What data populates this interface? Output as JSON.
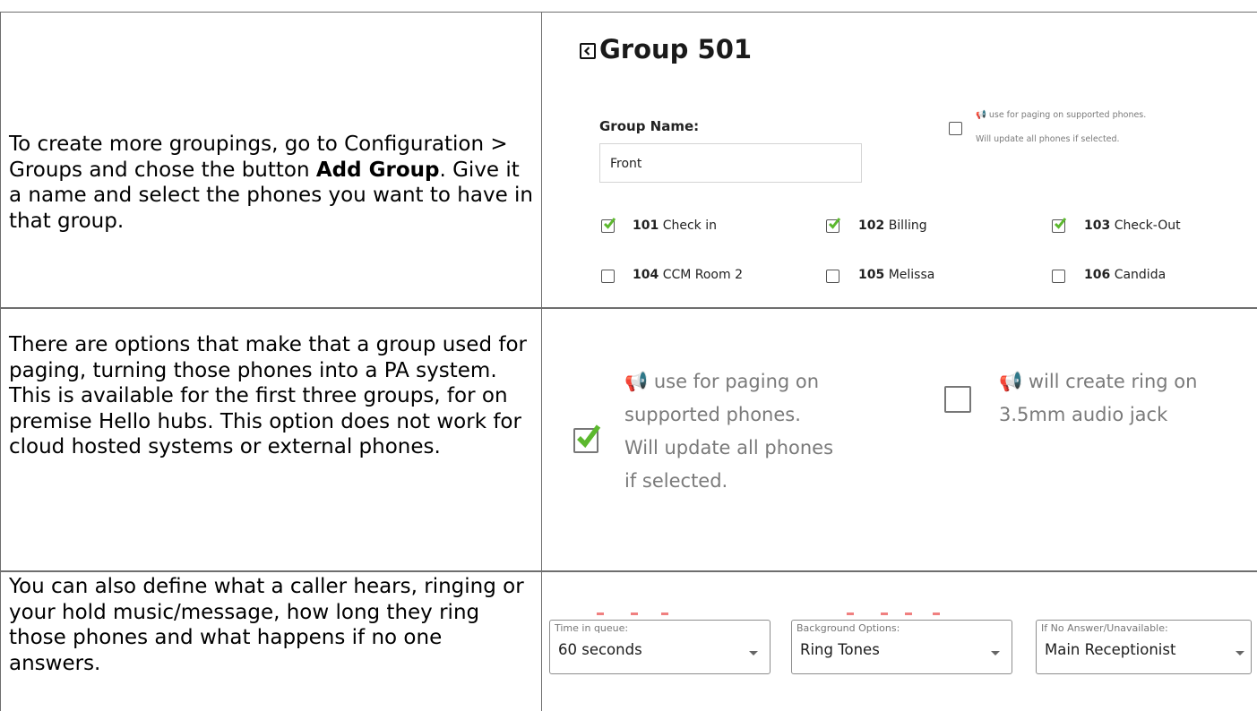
{
  "rows": [
    {
      "text_parts": {
        "before": "To create more groupings, go to Configuration > Groups and chose the button ",
        "bold": "Add Group",
        "after": ". Give it a name and select the phones you want to have in that group."
      }
    },
    {
      "text": "There are options that make that a group used for paging, turning those phones into a PA system. This is available for the first three groups, for on premise Hello hubs. This option does not work for cloud hosted systems or external phones."
    },
    {
      "text": "You can also define what a caller hears, ringing or your hold music/message, how long they ring those phones and what happens if no one answers."
    }
  ],
  "group_panel": {
    "title": "Group 501",
    "group_name_label": "Group Name:",
    "group_name_value": "Front",
    "paging_option": {
      "line1": "📢 use for paging on supported phones.",
      "line2": "Will update all phones if selected.",
      "checked": false
    },
    "phones": [
      {
        "ext": "101",
        "name": "Check in",
        "checked": true
      },
      {
        "ext": "102",
        "name": "Billing",
        "checked": true
      },
      {
        "ext": "103",
        "name": "Check-Out",
        "checked": true
      },
      {
        "ext": "104",
        "name": "CCM Room 2",
        "checked": false
      },
      {
        "ext": "105",
        "name": "Melissa",
        "checked": false
      },
      {
        "ext": "106",
        "name": "Candida",
        "checked": false
      }
    ]
  },
  "options_panel": {
    "paging": {
      "checked": true,
      "lines": [
        "📢 use for paging on",
        "supported phones.",
        "Will update all phones",
        "if selected."
      ]
    },
    "ring": {
      "checked": false,
      "lines": [
        "📢 will create ring on",
        "3.5mm audio jack"
      ]
    }
  },
  "queue_panel": {
    "selects": [
      {
        "label": "Time in queue:",
        "value": "60 seconds"
      },
      {
        "label": "Background Options:",
        "value": "Ring Tones"
      },
      {
        "label": "If No Answer/Unavailable:",
        "value": "Main Receptionist"
      }
    ]
  },
  "colors": {
    "check_green": "#5cb82e",
    "border": "#6e6e6e",
    "muted_text": "#7a7a7a"
  },
  "icons": [
    "back-arrow-icon",
    "megaphone-icon",
    "checkmark-icon",
    "caret-down-icon"
  ]
}
